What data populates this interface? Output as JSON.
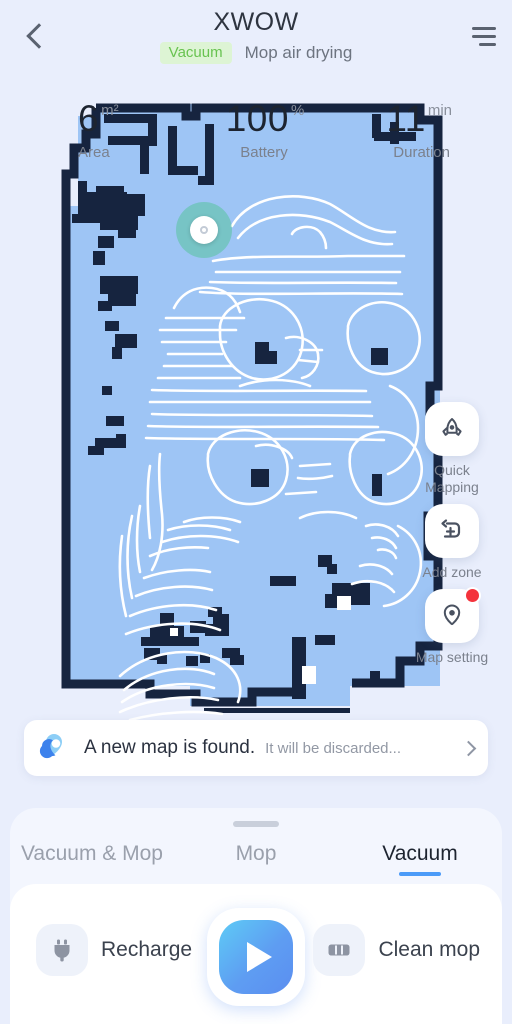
{
  "header": {
    "title": "XWOW",
    "mode_badge": "Vacuum",
    "secondary_status": "Mop air drying",
    "back_icon": "chevron-left-icon",
    "menu_icon": "hamburger-menu-icon"
  },
  "stats": [
    {
      "key": "area",
      "value": "6",
      "unit": "m²",
      "label": "Area"
    },
    {
      "key": "battery",
      "value": "100",
      "unit": "%",
      "label": "Battery"
    },
    {
      "key": "duration",
      "value": "11",
      "unit": "min",
      "label": "Duration"
    }
  ],
  "map": {
    "robot_marker": "robot-position-marker",
    "floor_color": "#9ec5f5",
    "wall_color": "#16243f",
    "path_color": "#ffffff",
    "background_color": "#e9eefc"
  },
  "map_tools": [
    {
      "key": "quick-mapping",
      "label": "Quick Mapping",
      "icon": "quick-mapping-icon",
      "badge": false
    },
    {
      "key": "add-zone",
      "label": "Add zone",
      "icon": "add-zone-icon",
      "badge": false
    },
    {
      "key": "map-setting",
      "label": "Map setting",
      "icon": "map-pin-icon",
      "badge": true
    }
  ],
  "banner": {
    "icon": "new-map-icon",
    "title": "A new map is found.",
    "subtitle": "It will be discarded...",
    "chevron": "chevron-right-icon"
  },
  "tabs": [
    {
      "key": "vacuum-and-mop",
      "label": "Vacuum & Mop",
      "active": false
    },
    {
      "key": "mop",
      "label": "Mop",
      "active": false
    },
    {
      "key": "vacuum",
      "label": "Vacuum",
      "active": true
    }
  ],
  "actions": {
    "recharge": {
      "label": "Recharge",
      "icon": "power-plug-icon"
    },
    "clean_mop": {
      "label": "Clean mop",
      "icon": "mop-pad-icon"
    },
    "start": {
      "label": "Start",
      "icon": "play-icon"
    }
  },
  "colors": {
    "accent_blue": "#4b9bf8",
    "badge_green_bg": "#ddf4d4",
    "badge_green_text": "#68c350",
    "alert_red": "#f4333c"
  }
}
